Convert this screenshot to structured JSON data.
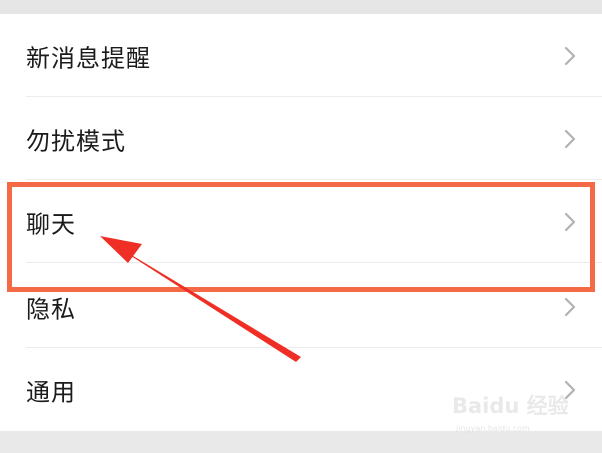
{
  "settings": {
    "items": [
      {
        "label": "新消息提醒"
      },
      {
        "label": "勿扰模式"
      },
      {
        "label": "聊天"
      },
      {
        "label": "隐私"
      },
      {
        "label": "通用"
      }
    ]
  },
  "annotation": {
    "highlighted_item": "聊天",
    "color": "#f46a46",
    "arrow_color": "#ef2f26"
  },
  "watermark": {
    "brand": "Baidu 经验",
    "url": "jingyan.baidu.com"
  },
  "colors": {
    "background": "#ededed",
    "card": "#ffffff",
    "text": "#1b1b1b",
    "chevron": "#b2b2b2"
  }
}
